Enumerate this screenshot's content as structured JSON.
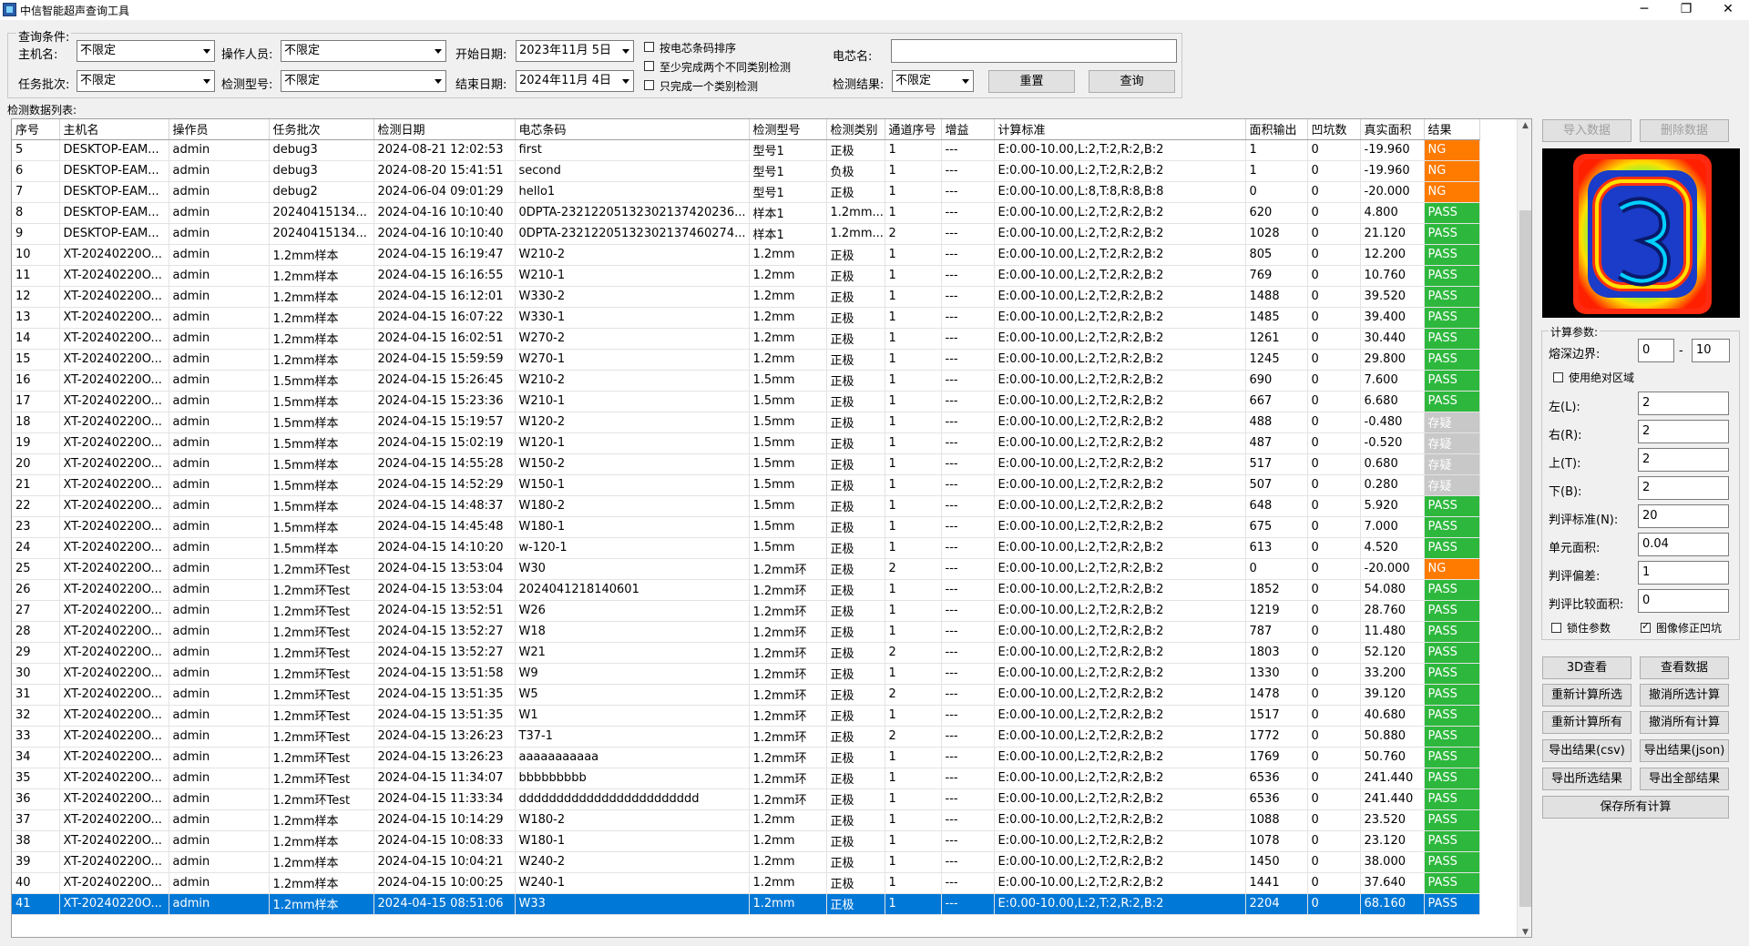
{
  "window": {
    "title": "中信智能超声查询工具",
    "minimize": "─",
    "maximize": "❐",
    "close": "✕"
  },
  "query": {
    "section_label": "查询条件:",
    "host_label": "主机名:",
    "host_value": "不限定",
    "operator_label": "操作人员:",
    "operator_value": "不限定",
    "start_label": "开始日期:",
    "start_value": "2023年11月 5日",
    "batch_label": "任务批次:",
    "batch_value": "不限定",
    "model_label": "检测型号:",
    "model_value": "不限定",
    "end_label": "结束日期:",
    "end_value": "2024年11月 4日",
    "opt1": "按电芯条码排序",
    "opt2": "至少完成两个不同类别检测",
    "opt3": "只完成一个类别检测",
    "cell_label": "电芯名:",
    "cell_value": "",
    "result_label": "检测结果:",
    "result_value": "不限定",
    "reset_label": "重置",
    "query_label": "查询"
  },
  "list_label": "检测数据列表:",
  "table": {
    "columns": [
      "序号",
      "主机名",
      "操作员",
      "任务批次",
      "检测日期",
      "电芯条码",
      "检测型号",
      "检测类别",
      "通道序号",
      "增益",
      "计算标准",
      "面积输出",
      "凹坑数",
      "真实面积",
      "结果"
    ],
    "rows": [
      [
        "5",
        "DESKTOP-EAM...",
        "admin",
        "debug3",
        "2024-08-21 12:02:53",
        "first",
        "型号1",
        "正极",
        "1",
        "---",
        "E:0.00-10.00,L:2,T:2,R:2,B:2",
        "1",
        "0",
        "-19.960",
        "NG"
      ],
      [
        "6",
        "DESKTOP-EAM...",
        "admin",
        "debug3",
        "2024-08-20 15:41:51",
        "second",
        "型号1",
        "负极",
        "1",
        "---",
        "E:0.00-10.00,L:2,T:2,R:2,B:2",
        "1",
        "0",
        "-19.960",
        "NG"
      ],
      [
        "7",
        "DESKTOP-EAM...",
        "admin",
        "debug2",
        "2024-06-04 09:01:29",
        "hello1",
        "型号1",
        "正极",
        "1",
        "---",
        "E:0.00-10.00,L:8,T:8,R:8,B:8",
        "0",
        "0",
        "-20.000",
        "NG"
      ],
      [
        "8",
        "DESKTOP-EAM...",
        "admin",
        "20240415134...",
        "2024-04-16 10:10:40",
        "0DPTA-23212205132302137420236...",
        "样本1",
        "1.2mm...",
        "1",
        "---",
        "E:0.00-10.00,L:2,T:2,R:2,B:2",
        "620",
        "0",
        "4.800",
        "PASS"
      ],
      [
        "9",
        "DESKTOP-EAM...",
        "admin",
        "20240415134...",
        "2024-04-16 10:10:40",
        "0DPTA-23212205132302137460274...",
        "样本1",
        "1.2mm...",
        "2",
        "---",
        "E:0.00-10.00,L:2,T:2,R:2,B:2",
        "1028",
        "0",
        "21.120",
        "PASS"
      ],
      [
        "10",
        "XT-20240220O...",
        "admin",
        "1.2mm样本",
        "2024-04-15 16:19:47",
        "W210-2",
        "1.2mm",
        "正极",
        "1",
        "---",
        "E:0.00-10.00,L:2,T:2,R:2,B:2",
        "805",
        "0",
        "12.200",
        "PASS"
      ],
      [
        "11",
        "XT-20240220O...",
        "admin",
        "1.2mm样本",
        "2024-04-15 16:16:55",
        "W210-1",
        "1.2mm",
        "正极",
        "1",
        "---",
        "E:0.00-10.00,L:2,T:2,R:2,B:2",
        "769",
        "0",
        "10.760",
        "PASS"
      ],
      [
        "12",
        "XT-20240220O...",
        "admin",
        "1.2mm样本",
        "2024-04-15 16:12:01",
        "W330-2",
        "1.2mm",
        "正极",
        "1",
        "---",
        "E:0.00-10.00,L:2,T:2,R:2,B:2",
        "1488",
        "0",
        "39.520",
        "PASS"
      ],
      [
        "13",
        "XT-20240220O...",
        "admin",
        "1.2mm样本",
        "2024-04-15 16:07:22",
        "W330-1",
        "1.2mm",
        "正极",
        "1",
        "---",
        "E:0.00-10.00,L:2,T:2,R:2,B:2",
        "1485",
        "0",
        "39.400",
        "PASS"
      ],
      [
        "14",
        "XT-20240220O...",
        "admin",
        "1.2mm样本",
        "2024-04-15 16:02:51",
        "W270-2",
        "1.2mm",
        "正极",
        "1",
        "---",
        "E:0.00-10.00,L:2,T:2,R:2,B:2",
        "1261",
        "0",
        "30.440",
        "PASS"
      ],
      [
        "15",
        "XT-20240220O...",
        "admin",
        "1.2mm样本",
        "2024-04-15 15:59:59",
        "W270-1",
        "1.2mm",
        "正极",
        "1",
        "---",
        "E:0.00-10.00,L:2,T:2,R:2,B:2",
        "1245",
        "0",
        "29.800",
        "PASS"
      ],
      [
        "16",
        "XT-20240220O...",
        "admin",
        "1.5mm样本",
        "2024-04-15 15:26:45",
        "W210-2",
        "1.5mm",
        "正极",
        "1",
        "---",
        "E:0.00-10.00,L:2,T:2,R:2,B:2",
        "690",
        "0",
        "7.600",
        "PASS"
      ],
      [
        "17",
        "XT-20240220O...",
        "admin",
        "1.5mm样本",
        "2024-04-15 15:23:36",
        "W210-1",
        "1.5mm",
        "正极",
        "1",
        "---",
        "E:0.00-10.00,L:2,T:2,R:2,B:2",
        "667",
        "0",
        "6.680",
        "PASS"
      ],
      [
        "18",
        "XT-20240220O...",
        "admin",
        "1.5mm样本",
        "2024-04-15 15:19:57",
        "W120-2",
        "1.5mm",
        "正极",
        "1",
        "---",
        "E:0.00-10.00,L:2,T:2,R:2,B:2",
        "488",
        "0",
        "-0.480",
        "存疑"
      ],
      [
        "19",
        "XT-20240220O...",
        "admin",
        "1.5mm样本",
        "2024-04-15 15:02:19",
        "W120-1",
        "1.5mm",
        "正极",
        "1",
        "---",
        "E:0.00-10.00,L:2,T:2,R:2,B:2",
        "487",
        "0",
        "-0.520",
        "存疑"
      ],
      [
        "20",
        "XT-20240220O...",
        "admin",
        "1.5mm样本",
        "2024-04-15 14:55:28",
        "W150-2",
        "1.5mm",
        "正极",
        "1",
        "---",
        "E:0.00-10.00,L:2,T:2,R:2,B:2",
        "517",
        "0",
        "0.680",
        "存疑"
      ],
      [
        "21",
        "XT-20240220O...",
        "admin",
        "1.5mm样本",
        "2024-04-15 14:52:29",
        "W150-1",
        "1.5mm",
        "正极",
        "1",
        "---",
        "E:0.00-10.00,L:2,T:2,R:2,B:2",
        "507",
        "0",
        "0.280",
        "存疑"
      ],
      [
        "22",
        "XT-20240220O...",
        "admin",
        "1.5mm样本",
        "2024-04-15 14:48:37",
        "W180-2",
        "1.5mm",
        "正极",
        "1",
        "---",
        "E:0.00-10.00,L:2,T:2,R:2,B:2",
        "648",
        "0",
        "5.920",
        "PASS"
      ],
      [
        "23",
        "XT-20240220O...",
        "admin",
        "1.5mm样本",
        "2024-04-15 14:45:48",
        "W180-1",
        "1.5mm",
        "正极",
        "1",
        "---",
        "E:0.00-10.00,L:2,T:2,R:2,B:2",
        "675",
        "0",
        "7.000",
        "PASS"
      ],
      [
        "24",
        "XT-20240220O...",
        "admin",
        "1.5mm样本",
        "2024-04-15 14:10:20",
        "w-120-1",
        "1.5mm",
        "正极",
        "1",
        "---",
        "E:0.00-10.00,L:2,T:2,R:2,B:2",
        "613",
        "0",
        "4.520",
        "PASS"
      ],
      [
        "25",
        "XT-20240220O...",
        "admin",
        "1.2mm环Test",
        "2024-04-15 13:53:04",
        "W30",
        "1.2mm环",
        "正极",
        "2",
        "---",
        "E:0.00-10.00,L:2,T:2,R:2,B:2",
        "0",
        "0",
        "-20.000",
        "NG"
      ],
      [
        "26",
        "XT-20240220O...",
        "admin",
        "1.2mm环Test",
        "2024-04-15 13:53:04",
        "2024041218140601",
        "1.2mm环",
        "正极",
        "1",
        "---",
        "E:0.00-10.00,L:2,T:2,R:2,B:2",
        "1852",
        "0",
        "54.080",
        "PASS"
      ],
      [
        "27",
        "XT-20240220O...",
        "admin",
        "1.2mm环Test",
        "2024-04-15 13:52:51",
        "W26",
        "1.2mm环",
        "正极",
        "1",
        "---",
        "E:0.00-10.00,L:2,T:2,R:2,B:2",
        "1219",
        "0",
        "28.760",
        "PASS"
      ],
      [
        "28",
        "XT-20240220O...",
        "admin",
        "1.2mm环Test",
        "2024-04-15 13:52:27",
        "W18",
        "1.2mm环",
        "正极",
        "1",
        "---",
        "E:0.00-10.00,L:2,T:2,R:2,B:2",
        "787",
        "0",
        "11.480",
        "PASS"
      ],
      [
        "29",
        "XT-20240220O...",
        "admin",
        "1.2mm环Test",
        "2024-04-15 13:52:27",
        "W21",
        "1.2mm环",
        "正极",
        "2",
        "---",
        "E:0.00-10.00,L:2,T:2,R:2,B:2",
        "1803",
        "0",
        "52.120",
        "PASS"
      ],
      [
        "30",
        "XT-20240220O...",
        "admin",
        "1.2mm环Test",
        "2024-04-15 13:51:58",
        "W9",
        "1.2mm环",
        "正极",
        "1",
        "---",
        "E:0.00-10.00,L:2,T:2,R:2,B:2",
        "1330",
        "0",
        "33.200",
        "PASS"
      ],
      [
        "31",
        "XT-20240220O...",
        "admin",
        "1.2mm环Test",
        "2024-04-15 13:51:35",
        "W5",
        "1.2mm环",
        "正极",
        "2",
        "---",
        "E:0.00-10.00,L:2,T:2,R:2,B:2",
        "1478",
        "0",
        "39.120",
        "PASS"
      ],
      [
        "32",
        "XT-20240220O...",
        "admin",
        "1.2mm环Test",
        "2024-04-15 13:51:35",
        "W1",
        "1.2mm环",
        "正极",
        "1",
        "---",
        "E:0.00-10.00,L:2,T:2,R:2,B:2",
        "1517",
        "0",
        "40.680",
        "PASS"
      ],
      [
        "33",
        "XT-20240220O...",
        "admin",
        "1.2mm环Test",
        "2024-04-15 13:26:23",
        "T37-1",
        "1.2mm环",
        "正极",
        "2",
        "---",
        "E:0.00-10.00,L:2,T:2,R:2,B:2",
        "1772",
        "0",
        "50.880",
        "PASS"
      ],
      [
        "34",
        "XT-20240220O...",
        "admin",
        "1.2mm环Test",
        "2024-04-15 13:26:23",
        "aaaaaaaaaaa",
        "1.2mm环",
        "正极",
        "1",
        "---",
        "E:0.00-10.00,L:2,T:2,R:2,B:2",
        "1769",
        "0",
        "50.760",
        "PASS"
      ],
      [
        "35",
        "XT-20240220O...",
        "admin",
        "1.2mm环Test",
        "2024-04-15 11:34:07",
        "bbbbbbbbb",
        "1.2mm环",
        "正极",
        "1",
        "---",
        "E:0.00-10.00,L:2,T:2,R:2,B:2",
        "6536",
        "0",
        "241.440",
        "PASS"
      ],
      [
        "36",
        "XT-20240220O...",
        "admin",
        "1.2mm环Test",
        "2024-04-15 11:33:34",
        "dddddddddddddddddddddddd",
        "1.2mm环",
        "正极",
        "1",
        "---",
        "E:0.00-10.00,L:2,T:2,R:2,B:2",
        "6536",
        "0",
        "241.440",
        "PASS"
      ],
      [
        "37",
        "XT-20240220O...",
        "admin",
        "1.2mm样本",
        "2024-04-15 10:14:29",
        "W180-2",
        "1.2mm",
        "正极",
        "1",
        "---",
        "E:0.00-10.00,L:2,T:2,R:2,B:2",
        "1088",
        "0",
        "23.520",
        "PASS"
      ],
      [
        "38",
        "XT-20240220O...",
        "admin",
        "1.2mm样本",
        "2024-04-15 10:08:33",
        "W180-1",
        "1.2mm",
        "正极",
        "1",
        "---",
        "E:0.00-10.00,L:2,T:2,R:2,B:2",
        "1078",
        "0",
        "23.120",
        "PASS"
      ],
      [
        "39",
        "XT-20240220O...",
        "admin",
        "1.2mm样本",
        "2024-04-15 10:04:21",
        "W240-2",
        "1.2mm",
        "正极",
        "1",
        "---",
        "E:0.00-10.00,L:2,T:2,R:2,B:2",
        "1450",
        "0",
        "38.000",
        "PASS"
      ],
      [
        "40",
        "XT-20240220O...",
        "admin",
        "1.2mm样本",
        "2024-04-15 10:00:25",
        "W240-1",
        "1.2mm",
        "正极",
        "1",
        "---",
        "E:0.00-10.00,L:2,T:2,R:2,B:2",
        "1441",
        "0",
        "37.640",
        "PASS"
      ],
      [
        "41",
        "XT-20240220O...",
        "admin",
        "1.2mm样本",
        "2024-04-15 08:51:06",
        "W33",
        "1.2mm",
        "正极",
        "1",
        "---",
        "E:0.00-10.00,L:2,T:2,R:2,B:2",
        "2204",
        "0",
        "68.160",
        "PASS"
      ]
    ],
    "selected_row": "41"
  },
  "result_colors": {
    "PASS": "#2db83d",
    "NG": "#ff7b00",
    "存疑": "#c8c8c8",
    "selected": "#0078d7"
  },
  "side": {
    "import_label": "导入数据",
    "delete_label": "删除数据",
    "params_title": "计算参数:",
    "depth_label": "熔深边界:",
    "depth_min": "0",
    "depth_sep": "-",
    "depth_max": "10",
    "abs_label": "使用绝对区域",
    "left_label": "左(L):",
    "left_value": "2",
    "right_label": "右(R):",
    "right_value": "2",
    "top_label": "上(T):",
    "top_value": "2",
    "bottom_label": "下(B):",
    "bottom_value": "2",
    "std_label": "判评标准(N):",
    "std_value": "20",
    "unit_label": "单元面积:",
    "unit_value": "0.04",
    "dev_label": "判评偏差:",
    "dev_value": "1",
    "ratio_label": "判评比较面积:",
    "ratio_value": "0",
    "lock_label": "锁住参数",
    "fix_label": "图像修正凹坑",
    "btn_3d": "3D查看",
    "btn_view": "查看数据",
    "btn_recalc_sel": "重新计算所选",
    "btn_undo_sel": "撤消所选计算",
    "btn_recalc_all": "重新计算所有",
    "btn_undo_all": "撤消所有计算",
    "btn_export_csv": "导出结果(csv)",
    "btn_export_json": "导出结果(json)",
    "btn_export_sel": "导出所选结果",
    "btn_export_all": "导出全部结果",
    "btn_save_all": "保存所有计算"
  }
}
